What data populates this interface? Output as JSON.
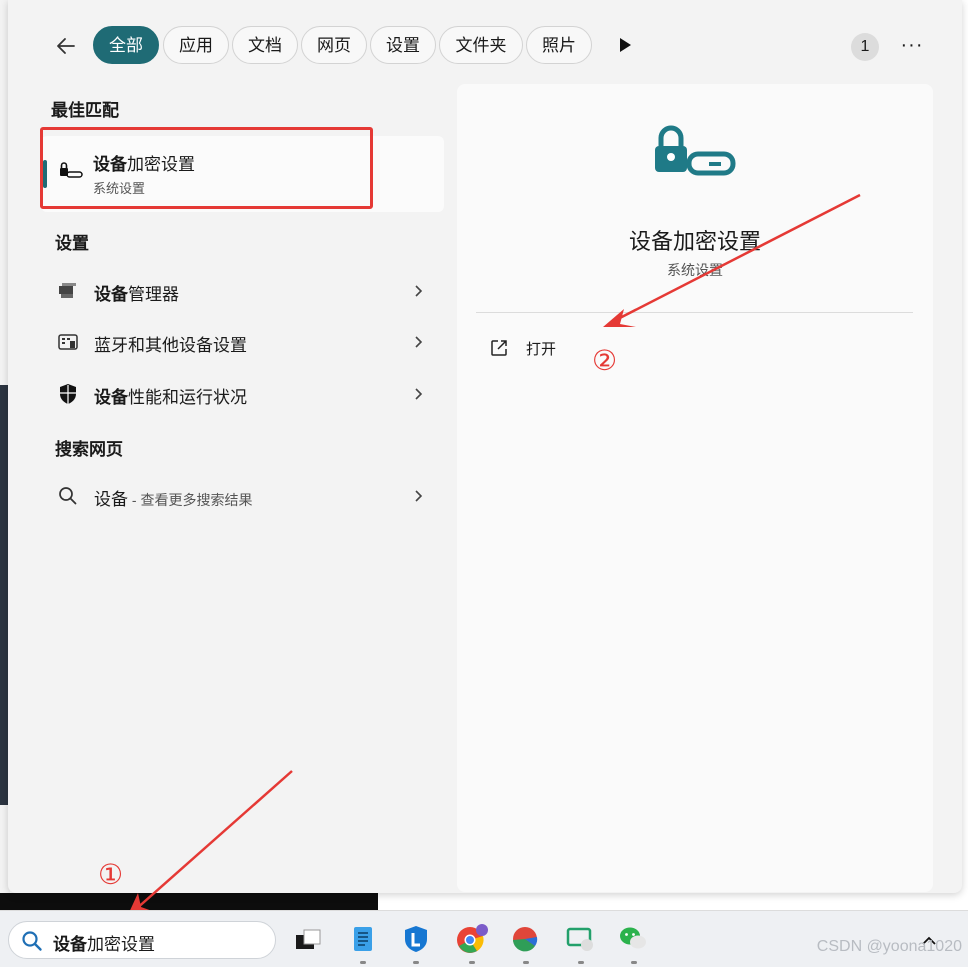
{
  "filter_bar": {
    "back_icon": "arrow-left-icon",
    "chips": [
      "全部",
      "应用",
      "文档",
      "网页",
      "设置",
      "文件夹",
      "照片"
    ],
    "active_chip": "全部",
    "badge": "1",
    "more": "···"
  },
  "best_match": {
    "section": "最佳匹配",
    "title_bold": "设备",
    "title_rest": "加密设置",
    "subtitle": "系统设置",
    "icon": "lock-key-icon"
  },
  "settings": {
    "section": "设置",
    "items": [
      {
        "bold": "设备",
        "rest": "管理器",
        "icon": "device-manager-icon"
      },
      {
        "bold": "",
        "rest": "蓝牙和其他设备设置",
        "icon": "keyboard-devices-icon"
      },
      {
        "bold": "设备",
        "rest": "性能和运行状况",
        "icon": "shield-icon"
      }
    ]
  },
  "web": {
    "section": "搜索网页",
    "query": "设备",
    "hint": " - 查看更多搜索结果"
  },
  "preview": {
    "title": "设备加密设置",
    "subtitle": "系统设置",
    "open_label": "打开",
    "icon": "lock-key-icon",
    "open_icon": "open-external-icon"
  },
  "annotations": {
    "one": "①",
    "two": "②"
  },
  "taskbar": {
    "search_bold": "设备",
    "search_rest": "加密设置",
    "apps": [
      "task-view-icon",
      "notepad-icon",
      "security-app-icon",
      "chrome-icon",
      "browser-app-icon",
      "remote-app-icon",
      "wechat-icon"
    ],
    "watermark": "CSDN @yoona1020"
  },
  "colors": {
    "accent": "#1f6b75",
    "annotation": "#e53935"
  }
}
